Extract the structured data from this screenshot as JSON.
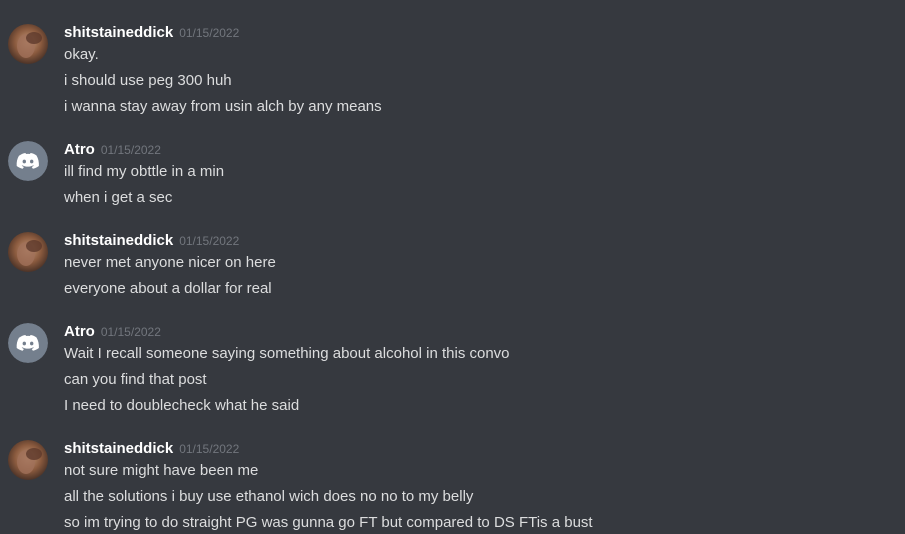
{
  "colors": {
    "background": "#36393f",
    "username": "#ffffff",
    "timestamp": "#72767d",
    "message_text": "#dcddde",
    "default_avatar": "#747f8d"
  },
  "groups": [
    {
      "username": "shitstaineddick",
      "timestamp": "01/15/2022",
      "avatar": "photo-avatar",
      "messages": [
        "okay.",
        "i should use peg 300 huh",
        "i wanna stay away from usin alch by any means"
      ]
    },
    {
      "username": "Atro",
      "timestamp": "01/15/2022",
      "avatar": "discord-logo-icon",
      "messages": [
        "ill find my obttle in a min",
        "when i get a sec"
      ]
    },
    {
      "username": "shitstaineddick",
      "timestamp": "01/15/2022",
      "avatar": "photo-avatar",
      "messages": [
        "never met anyone nicer on here",
        "everyone about a dollar for real"
      ]
    },
    {
      "username": "Atro",
      "timestamp": "01/15/2022",
      "avatar": "discord-logo-icon",
      "messages": [
        "Wait I recall someone saying something about alcohol in this convo",
        "can you find that post",
        "I need to doublecheck what he said"
      ]
    },
    {
      "username": "shitstaineddick",
      "timestamp": "01/15/2022",
      "avatar": "photo-avatar",
      "messages": [
        "not sure might have been me",
        "all the solutions i buy use ethanol wich does no no to my belly",
        "so im trying to do straight PG was gunna go FT but compared to DS FTis a bust"
      ]
    }
  ]
}
